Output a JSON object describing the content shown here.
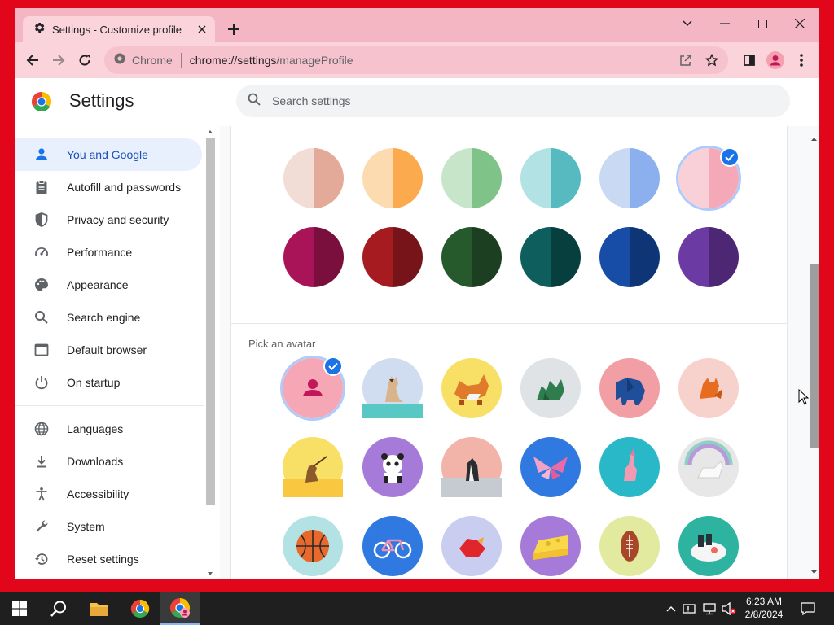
{
  "browser": {
    "tab_title": "Settings - Customize profile",
    "omnibox_chip": "Chrome",
    "url_host": "chrome://settings",
    "url_path": "/manageProfile"
  },
  "settings": {
    "title": "Settings",
    "search_placeholder": "Search settings"
  },
  "sidebar": {
    "items": [
      {
        "label": "You and Google",
        "icon": "person-icon",
        "active": true
      },
      {
        "label": "Autofill and passwords",
        "icon": "clipboard-icon"
      },
      {
        "label": "Privacy and security",
        "icon": "shield-icon"
      },
      {
        "label": "Performance",
        "icon": "speedometer-icon"
      },
      {
        "label": "Appearance",
        "icon": "palette-icon"
      },
      {
        "label": "Search engine",
        "icon": "search-icon"
      },
      {
        "label": "Default browser",
        "icon": "browser-window-icon"
      },
      {
        "label": "On startup",
        "icon": "power-icon"
      },
      {
        "label": "Languages",
        "icon": "globe-icon"
      },
      {
        "label": "Downloads",
        "icon": "download-icon"
      },
      {
        "label": "Accessibility",
        "icon": "accessibility-icon"
      },
      {
        "label": "System",
        "icon": "wrench-icon"
      },
      {
        "label": "Reset settings",
        "icon": "reset-history-icon"
      }
    ]
  },
  "profile": {
    "color_rows": [
      [
        {
          "light": "#f1dcd6",
          "dark": "#e3a999"
        },
        {
          "light": "#fddbb0",
          "dark": "#fbab4d"
        },
        {
          "light": "#c7e6c9",
          "dark": "#7fc388"
        },
        {
          "light": "#b3e2e4",
          "dark": "#57bac0"
        },
        {
          "light": "#c9d9f4",
          "dark": "#8cb0ee"
        },
        {
          "light": "#f9cfd8",
          "dark": "#f5a9b8",
          "selected": true
        }
      ],
      [
        {
          "light": "#a91458",
          "dark": "#7a0f3d"
        },
        {
          "light": "#a51b1f",
          "dark": "#761419"
        },
        {
          "light": "#26592c",
          "dark": "#1b3f20"
        },
        {
          "light": "#0d5e5c",
          "dark": "#063f3e"
        },
        {
          "light": "#174da6",
          "dark": "#0e3677"
        },
        {
          "light": "#6c3aa3",
          "dark": "#4d2774"
        }
      ]
    ],
    "avatar_section_label": "Pick an avatar",
    "avatars": [
      {
        "name": "generic-person-avatar",
        "bg": "#f6a7b6",
        "selected": true
      },
      {
        "name": "cat-avatar",
        "bg": "#d0dcf0"
      },
      {
        "name": "corgi-avatar",
        "bg": "#f8e067"
      },
      {
        "name": "dragon-avatar",
        "bg": "#e0e3e6"
      },
      {
        "name": "elephant-avatar",
        "bg": "#f29ea5"
      },
      {
        "name": "fox-avatar",
        "bg": "#f7d2cc"
      },
      {
        "name": "monkey-avatar",
        "bg": "#f8e067"
      },
      {
        "name": "panda-avatar",
        "bg": "#a57ad8"
      },
      {
        "name": "penguin-avatar",
        "bg": "#f2b3a8"
      },
      {
        "name": "butterfly-avatar",
        "bg": "#2f79e0"
      },
      {
        "name": "rabbit-avatar",
        "bg": "#29b8c8"
      },
      {
        "name": "unicorn-avatar",
        "bg": "#e7e7e7"
      },
      {
        "name": "basketball-avatar",
        "bg": "#b3e2e4"
      },
      {
        "name": "bicycle-avatar",
        "bg": "#2f79e0"
      },
      {
        "name": "bird-avatar",
        "bg": "#c9cdf0"
      },
      {
        "name": "cheese-avatar",
        "bg": "#a57ad8"
      },
      {
        "name": "football-avatar",
        "bg": "#e1ea9f"
      },
      {
        "name": "sushi-avatar",
        "bg": "#2db3a0"
      }
    ]
  },
  "taskbar": {
    "time": "6:23 AM",
    "date": "2/8/2024"
  },
  "colors": {
    "title_bar": "#f5b6c3",
    "toolbar": "#fbd3db",
    "accent": "#1a73e8",
    "desktop": "#e2061b"
  }
}
